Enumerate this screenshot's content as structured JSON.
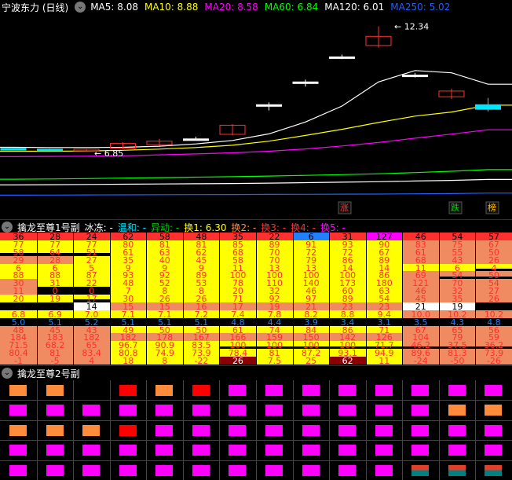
{
  "colors": {
    "bg": "#000000",
    "red": "#ff3030",
    "yellow": "#ffff00",
    "orange": "#ff8c3c",
    "magenta": "#ff00ff",
    "cyan": "#00e5ff",
    "green": "#00d000",
    "blue": "#2060ff",
    "white": "#ffffff",
    "darkred": "#8b0000",
    "salmon": "#f08060"
  },
  "header": {
    "stock_title": "宁波东力 (日线)",
    "collapse_icon": "chevron-down-icon",
    "ma": [
      {
        "label": "MA5: 8.08",
        "color": "#ffffff"
      },
      {
        "label": "MA10: 8.88",
        "color": "#ffff00"
      },
      {
        "label": "MA20: 8.58",
        "color": "#ff00ff"
      },
      {
        "label": "MA60: 6.84",
        "color": "#00ff00"
      },
      {
        "label": "MA120: 6.01",
        "color": "#ffffff"
      },
      {
        "label": "MA250: 5.02",
        "color": "#2060ff"
      }
    ]
  },
  "price_chart": {
    "high_label": "12.34",
    "low_label": "6.85",
    "badges": [
      {
        "text": "涨",
        "color": "#ff3030"
      },
      {
        "text": "跌",
        "color": "#00d000"
      },
      {
        "text": "榜",
        "color": "#ffc000"
      }
    ],
    "candles": [
      {
        "o": 6.98,
        "c": 6.92,
        "h": 7.0,
        "l": 6.9
      },
      {
        "o": 6.95,
        "c": 6.9,
        "h": 6.97,
        "l": 6.88
      },
      {
        "o": 6.9,
        "c": 6.95,
        "h": 6.96,
        "l": 6.85
      },
      {
        "o": 7.0,
        "c": 7.2,
        "h": 7.25,
        "l": 6.95
      },
      {
        "o": 7.15,
        "c": 7.3,
        "h": 7.4,
        "l": 7.1
      },
      {
        "o": 7.4,
        "c": 7.4,
        "h": 7.5,
        "l": 7.35
      },
      {
        "o": 7.6,
        "c": 8.0,
        "h": 8.05,
        "l": 7.55
      },
      {
        "o": 8.9,
        "c": 8.9,
        "h": 9.0,
        "l": 8.65
      },
      {
        "o": 9.9,
        "c": 9.9,
        "h": 10.0,
        "l": 9.7
      },
      {
        "o": 11.0,
        "c": 11.0,
        "h": 11.1,
        "l": 10.9
      },
      {
        "o": 11.5,
        "c": 11.9,
        "h": 12.34,
        "l": 11.4
      },
      {
        "o": 10.2,
        "c": 10.2,
        "h": 10.3,
        "l": 10.1
      },
      {
        "o": 9.25,
        "c": 9.5,
        "h": 9.6,
        "l": 9.15
      },
      {
        "o": 8.9,
        "c": 8.7,
        "h": 9.2,
        "l": 8.6
      }
    ],
    "ma_lines": [
      {
        "name": "MA5",
        "color": "#ffffff",
        "values": [
          7.03,
          7.02,
          7.02,
          7.03,
          7.08,
          7.18,
          7.33,
          7.62,
          8.14,
          8.84,
          9.9,
          10.4,
          10.3,
          9.8
        ]
      },
      {
        "name": "MA10",
        "color": "#ffff00",
        "values": [
          6.86,
          6.86,
          6.87,
          6.9,
          6.95,
          7.02,
          7.12,
          7.3,
          7.55,
          7.82,
          8.12,
          8.4,
          8.58,
          8.88
        ]
      },
      {
        "name": "MA20",
        "color": "#ff00ff",
        "values": [
          6.62,
          6.63,
          6.64,
          6.66,
          6.7,
          6.74,
          6.79,
          6.86,
          6.96,
          7.09,
          7.24,
          7.43,
          7.61,
          7.8
        ]
      },
      {
        "name": "MA60",
        "color": "#00ff00",
        "values": [
          5.63,
          5.64,
          5.66,
          5.68,
          5.7,
          5.72,
          5.74,
          5.77,
          5.8,
          5.83,
          5.87,
          5.92,
          5.98,
          6.05
        ]
      },
      {
        "name": "MA120",
        "color": "#ffffff",
        "values": [
          5.38,
          5.39,
          5.4,
          5.41,
          5.42,
          5.43,
          5.44,
          5.46,
          5.48,
          5.5,
          5.52,
          5.55,
          5.58,
          5.62
        ]
      },
      {
        "name": "MA250",
        "color": "#2060ff",
        "values": [
          4.93,
          4.935,
          4.94,
          4.945,
          4.95,
          4.955,
          4.96,
          4.965,
          4.97,
          4.975,
          4.98,
          4.99,
          5.0,
          5.02
        ]
      }
    ]
  },
  "panel1": {
    "title": "擒龙至尊1号副",
    "legend": [
      {
        "text": "冰冻: -",
        "color": "#ffffff"
      },
      {
        "text": "温和: -",
        "color": "#00e5ff"
      },
      {
        "text": "异动: -",
        "color": "#00d000"
      },
      {
        "text": "换1: 6.30",
        "color": "#ffff00"
      },
      {
        "text": "换2: -",
        "color": "#ff8c3c"
      },
      {
        "text": "换3: -",
        "color": "#ff3030"
      },
      {
        "text": "换4: -",
        "color": "#ff3030"
      },
      {
        "text": "换5: -",
        "color": "#ff00ff"
      }
    ],
    "rows": [
      [
        "36",
        "28",
        "24",
        "62",
        "58",
        "48",
        "35",
        "22",
        "6",
        "31",
        "127",
        "46",
        "54",
        "57"
      ],
      [
        "77",
        "77",
        "77",
        "80",
        "81",
        "81",
        "85",
        "89",
        "91",
        "93",
        "90",
        "83",
        "75",
        "67"
      ],
      [
        "58",
        "64",
        "51",
        "61",
        "63",
        "62",
        "68",
        "70",
        "72",
        "72",
        "67",
        "61",
        "55",
        "50"
      ],
      [
        "29",
        "28",
        "27",
        "35",
        "40",
        "45",
        "58",
        "70",
        "79",
        "86",
        "89",
        "68",
        "43",
        "26"
      ],
      [
        "6",
        "6",
        "5",
        "9",
        "9",
        "9",
        "11",
        "13",
        "13",
        "14",
        "14",
        "11",
        "6",
        "4"
      ],
      [
        "88",
        "88",
        "87",
        "93",
        "92",
        "89",
        "100",
        "100",
        "100",
        "100",
        "86",
        "69",
        "54",
        "50"
      ],
      [
        "30",
        "31",
        "22",
        "48",
        "52",
        "53",
        "78",
        "110",
        "140",
        "173",
        "180",
        "121",
        "70",
        "54"
      ],
      [
        "11",
        "0",
        "0",
        "7",
        "8",
        "8",
        "20",
        "32",
        "46",
        "60",
        "63",
        "46",
        "32",
        "27"
      ],
      [
        "20",
        "19",
        "17",
        "30",
        "26",
        "26",
        "71",
        "92",
        "97",
        "89",
        "54",
        "45",
        "35",
        "26"
      ],
      [
        "",
        "",
        "14",
        "15",
        "15",
        "16",
        "17",
        "19",
        "21",
        "23",
        "23",
        "21",
        "19",
        ""
      ],
      [
        "6.8",
        "6.9",
        "7.0",
        "7.1",
        "7.1",
        "7.2",
        "7.4",
        "7.8",
        "8.2",
        "8.8",
        "9.4",
        "10.0",
        "10.2",
        "10.2"
      ],
      [
        "5.0",
        "5.1",
        "5.2",
        "5.1",
        "5.1",
        "5.1",
        "4.8",
        "4.4",
        "3.9",
        "3.4",
        "3.1",
        "3.5",
        "4.3",
        "4.8"
      ],
      [
        "48",
        "45",
        "43",
        "49",
        "50",
        "50",
        "61",
        "74",
        "84",
        "86",
        "71",
        "67",
        "65",
        "56"
      ],
      [
        "184",
        "183",
        "182",
        "182",
        "178",
        "167",
        "166",
        "159",
        "150",
        "142",
        "126",
        "104",
        "79",
        "59"
      ],
      [
        "71.5",
        "68.2",
        "65",
        "96.7",
        "90.9",
        "83.5",
        "100",
        "100",
        "100",
        "100",
        "71.7",
        "46.2",
        "37.5",
        "36.2"
      ],
      [
        "80.4",
        "81",
        "83.4",
        "80.8",
        "74.9",
        "73.9",
        "78.4",
        "81",
        "87.2",
        "93.1",
        "94.9",
        "89.6",
        "81.3",
        "73.9"
      ],
      [
        "-1",
        "-5",
        "4",
        "18",
        "8",
        "-22",
        "26",
        "7.5",
        "25",
        "62",
        "11",
        "-24",
        "-50",
        "-26"
      ]
    ],
    "styles": [
      [
        "R",
        "R",
        "R",
        "R",
        "R",
        "R",
        "R",
        "R",
        "B",
        "R",
        "M",
        "R",
        "R",
        "R"
      ],
      [
        "Y",
        "Y",
        "Y",
        "Y",
        "Y",
        "Y",
        "Y",
        "Y",
        "Y",
        "Y",
        "Y",
        "O",
        "O",
        "O"
      ],
      [
        "YK",
        "YK",
        "YK",
        "Y",
        "Y",
        "Y",
        "Y",
        "Y",
        "Y",
        "Y",
        "Y",
        "O",
        "O",
        "O"
      ],
      [
        "O",
        "O",
        "Y",
        "Y",
        "Y",
        "Y",
        "Y",
        "Y",
        "Y",
        "Y",
        "Y",
        "O",
        "O",
        "O"
      ],
      [
        "Y",
        "Y",
        "Y",
        "Y",
        "Y",
        "Y",
        "Y",
        "Y",
        "Y",
        "Y",
        "Y",
        "Y",
        "Y",
        "YK"
      ],
      [
        "Y",
        "Y",
        "Y",
        "Y",
        "Y",
        "Y",
        "Y",
        "Y",
        "Y",
        "Y",
        "Y",
        "O",
        "OK",
        "OK"
      ],
      [
        "O",
        "Y",
        "Y",
        "Y",
        "Y",
        "Y",
        "Y",
        "Y",
        "Y",
        "Y",
        "Y",
        "O",
        "O",
        "O"
      ],
      [
        "O",
        "K",
        "K",
        "Y",
        "Y",
        "Y",
        "Y",
        "Y",
        "Y",
        "Y",
        "Y",
        "O",
        "O",
        "O"
      ],
      [
        "Y",
        "Y",
        "YK",
        "Y",
        "Y",
        "Y",
        "Y",
        "Y",
        "Y",
        "Y",
        "Y",
        "O",
        "O",
        "O"
      ],
      [
        "K",
        "K",
        "W",
        "O",
        "O",
        "O",
        "O",
        "O",
        "O",
        "O",
        "O",
        "W",
        "W",
        "K"
      ],
      [
        "Y",
        "Y",
        "Y",
        "Y",
        "Y",
        "Y",
        "Y",
        "Y",
        "Y",
        "Y",
        "Y",
        "O",
        "O",
        "O"
      ],
      [
        "KB",
        "KB",
        "KB",
        "KB",
        "KB",
        "KB",
        "KB",
        "KB",
        "KB",
        "KB",
        "KB",
        "KB",
        "KB",
        "KB"
      ],
      [
        "O",
        "O",
        "O",
        "Y",
        "Y",
        "Y",
        "Y",
        "Y",
        "Y",
        "Y",
        "Y",
        "O",
        "O",
        "O"
      ],
      [
        "O",
        "O",
        "O",
        "O",
        "O",
        "O",
        "O",
        "O",
        "O",
        "O",
        "O",
        "O",
        "O",
        "O"
      ],
      [
        "O",
        "O",
        "O",
        "Y",
        "Y",
        "Y",
        "YK",
        "YK",
        "YK",
        "YK",
        "YK",
        "OK",
        "OK",
        "OK"
      ],
      [
        "O",
        "O",
        "O",
        "Y",
        "Y",
        "Y",
        "Y",
        "Y",
        "Y",
        "Y",
        "Y",
        "O",
        "O",
        "O"
      ],
      [
        "O",
        "O",
        "O",
        "Y",
        "Y",
        "Y",
        "D",
        "Y",
        "Y",
        "D",
        "Y",
        "O",
        "O",
        "O"
      ]
    ]
  },
  "panel2": {
    "title": "擒龙至尊2号副",
    "rows": [
      [
        "O",
        "O",
        "",
        "R",
        "O",
        "R",
        "M",
        "M",
        "M",
        "M",
        "M",
        "M",
        "M",
        "M"
      ],
      [
        "M",
        "M",
        "M",
        "M",
        "M",
        "M",
        "M",
        "M",
        "M",
        "M",
        "M",
        "M",
        "O",
        "O"
      ],
      [
        "O",
        "O",
        "O",
        "R",
        "M",
        "M",
        "M",
        "M",
        "M",
        "M",
        "M",
        "M",
        "M",
        "M"
      ],
      [
        "M",
        "M",
        "M",
        "M",
        "M",
        "M",
        "M",
        "M",
        "M",
        "M",
        "M",
        "M",
        "M",
        "M"
      ],
      [
        "M",
        "M",
        "M",
        "M",
        "M",
        "M",
        "M",
        "M",
        "M",
        "M",
        "M",
        "T",
        "T",
        "T"
      ]
    ]
  }
}
